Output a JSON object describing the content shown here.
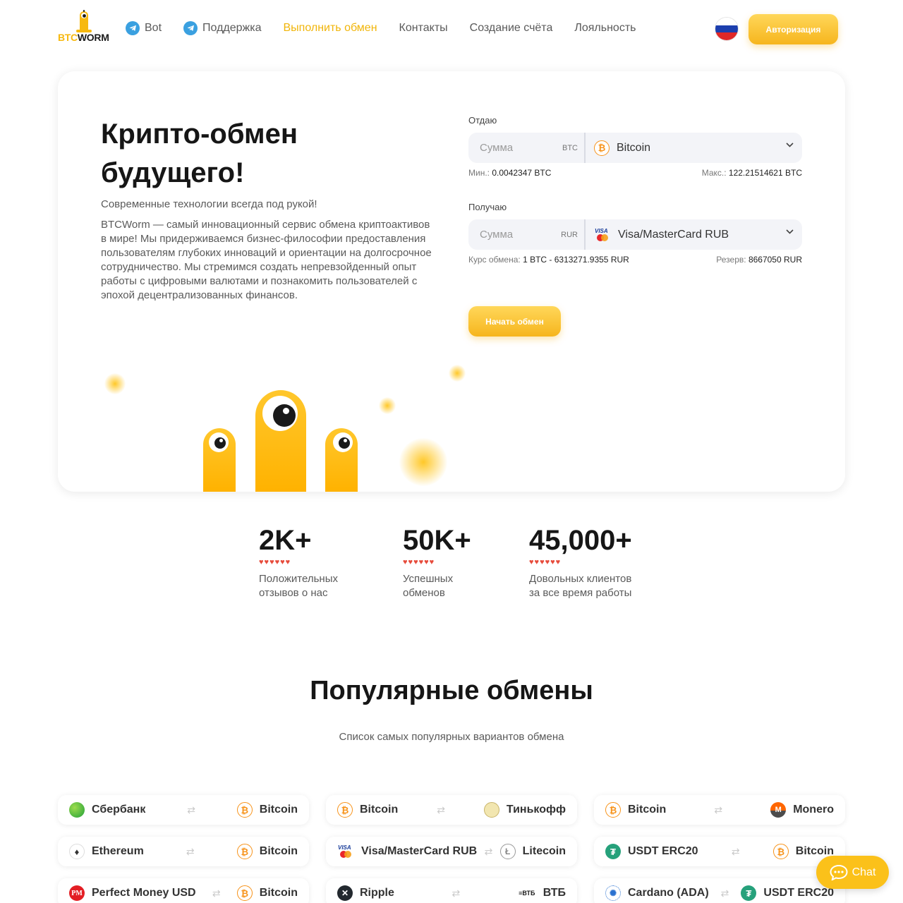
{
  "brand": {
    "logo_part1": "BTC",
    "logo_part2": "WORM"
  },
  "nav": [
    {
      "label": "Bot",
      "icon": "telegram-icon"
    },
    {
      "label": "Поддержка",
      "icon": "telegram-icon"
    },
    {
      "label": "Выполнить обмен",
      "active": true
    },
    {
      "label": "Контакты"
    },
    {
      "label": "Создание счёта"
    },
    {
      "label": "Лояльность"
    }
  ],
  "header": {
    "language_flag": "russia-flag-icon",
    "auth_label": "Авторизация"
  },
  "hero": {
    "title": "Крипто-обмен будущего!",
    "subtitle": "Современные технологии всегда под рукой!",
    "description": "BTCWorm — самый инновационный сервис обмена криптоактивов в мире! Мы придерживаемся бизнес-философии предоставления пользователям глубоких инноваций и ориентации на долгосрочное сотрудничество. Мы стремимся создать непревзойденный опыт работы с цифровыми валютами и познакомить пользователей с эпохой децентрализованных финансов."
  },
  "exchange_form": {
    "give": {
      "label": "Отдаю",
      "placeholder": "Сумма",
      "currency_code": "BTC",
      "selected": "Bitcoin",
      "min_label": "Мин.:",
      "min_value": "0.0042347 BTC",
      "max_label": "Макс.:",
      "max_value": "122.21514621 BTC"
    },
    "get": {
      "label": "Получаю",
      "placeholder": "Сумма",
      "currency_code": "RUR",
      "selected": "Visa/MasterCard RUB",
      "rate_label": "Курс обмена:",
      "rate_value": "1 BTC - 6313271.9355 RUR",
      "reserve_label": "Резерв:",
      "reserve_value": "8667050 RUR"
    },
    "submit_label": "Начать обмен"
  },
  "stats": [
    {
      "value": "2K+",
      "hearts": "♥♥♥♥♥♥",
      "caption_line1": "Положительных",
      "caption_line2": "отзывов о нас"
    },
    {
      "value": "50K+",
      "hearts": "♥♥♥♥♥♥",
      "caption_line1": "Успешных",
      "caption_line2": "обменов"
    },
    {
      "value": "45,000+",
      "hearts": "♥♥♥♥♥♥",
      "caption_line1": "Довольных клиентов",
      "caption_line2": "за все время работы"
    }
  ],
  "popular": {
    "title": "Популярные обмены",
    "subtitle": "Список самых популярных вариантов обмена",
    "pairs": [
      {
        "from": "Сбербанк",
        "to": "Bitcoin"
      },
      {
        "from": "Bitcoin",
        "to": "Тинькофф"
      },
      {
        "from": "Bitcoin",
        "to": "Monero"
      },
      {
        "from": "Ethereum",
        "to": "Bitcoin"
      },
      {
        "from": "Visa/MasterCard RUB",
        "to": "Litecoin"
      },
      {
        "from": "USDT ERC20",
        "to": "Bitcoin"
      },
      {
        "from": "Perfect Money USD",
        "to": "Bitcoin"
      },
      {
        "from": "Ripple",
        "to": "ВТБ"
      },
      {
        "from": "Cardano (ADA)",
        "to": "USDT ERC20"
      }
    ]
  },
  "chat": {
    "label": "Chat"
  },
  "colors": {
    "accent": "#f7b90f",
    "button_gradient_top": "#ffd75a",
    "button_gradient_bottom": "#f6b51d",
    "bitcoin": "#f7931a",
    "heart": "#e74c3c"
  }
}
